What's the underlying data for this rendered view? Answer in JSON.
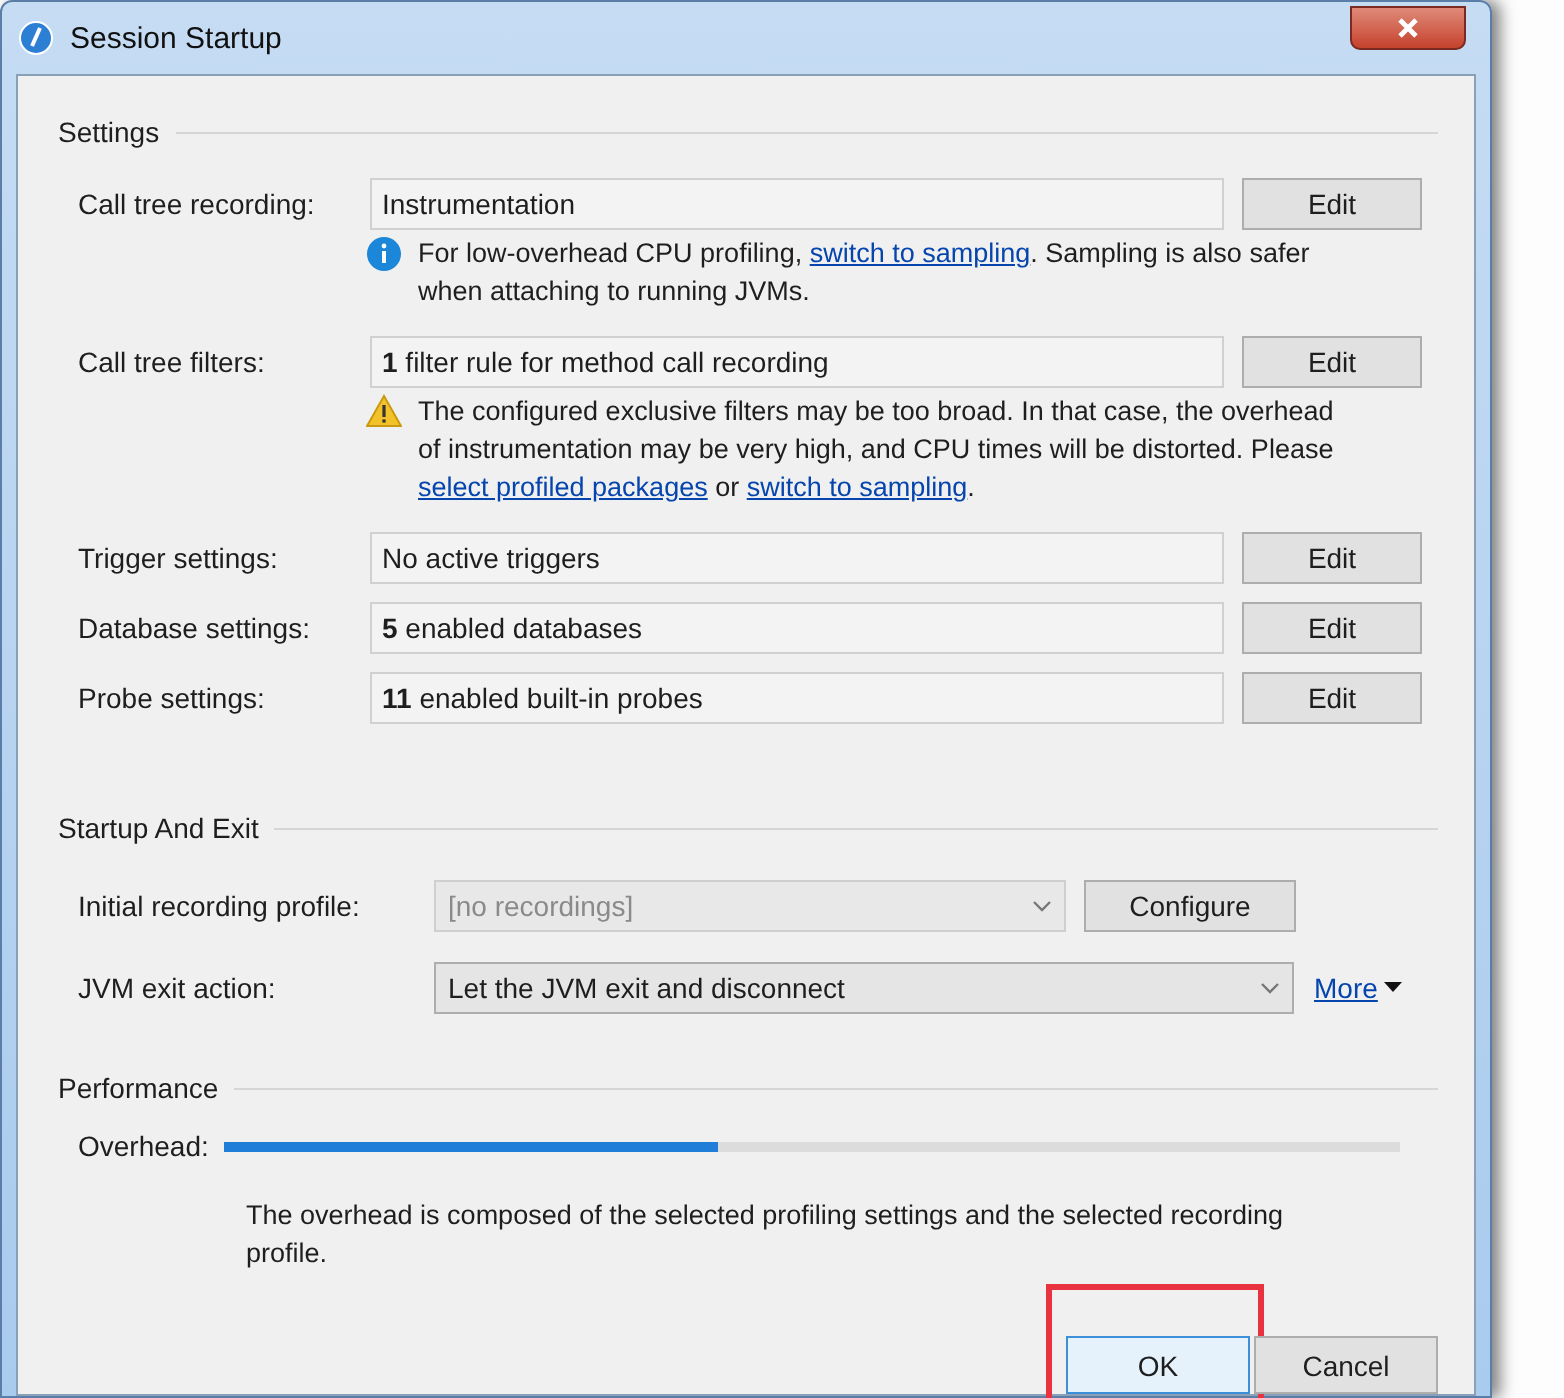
{
  "window": {
    "title": "Session Startup"
  },
  "settings": {
    "heading": "Settings",
    "rows": [
      {
        "label": "Call tree recording:",
        "value": "Instrumentation",
        "button": "Edit",
        "note": {
          "kind": "info",
          "parts": [
            {
              "kind": "text",
              "text": "For low-overhead CPU profiling, "
            },
            {
              "kind": "link",
              "text": "switch to sampling"
            },
            {
              "kind": "text",
              "text": ". Sampling is also safer when attaching to running JVMs."
            }
          ]
        }
      },
      {
        "label": "Call tree filters:",
        "value": "**1** filter rule for method call recording",
        "button": "Edit",
        "note": {
          "kind": "warning",
          "parts": [
            {
              "kind": "text",
              "text": "The configured exclusive filters may be too broad. In that case, the overhead of instrumentation may be very high, and CPU times will be distorted. Please "
            },
            {
              "kind": "link",
              "text": "select profiled packages"
            },
            {
              "kind": "text",
              "text": " or "
            },
            {
              "kind": "link",
              "text": "switch to sampling"
            },
            {
              "kind": "text",
              "text": "."
            }
          ]
        }
      },
      {
        "label": "Trigger settings:",
        "value": "No active triggers",
        "button": "Edit"
      },
      {
        "label": "Database settings:",
        "value": "**5** enabled databases",
        "button": "Edit"
      },
      {
        "label": "Probe settings:",
        "value": "**11** enabled built-in probes",
        "button": "Edit"
      }
    ]
  },
  "startup_and_exit": {
    "heading": "Startup And Exit",
    "rows": [
      {
        "label": "Initial recording profile:",
        "value": "[no recordings]",
        "disabled": true,
        "button": "Configure"
      },
      {
        "label": "JVM exit action:",
        "value": "Let the JVM exit and disconnect",
        "disabled": false,
        "link": "More"
      }
    ]
  },
  "performance": {
    "heading": "Performance",
    "label": "Overhead:",
    "level": 0.42,
    "description": "The overhead is composed of the selected profiling settings and the selected recording profile."
  },
  "buttons": [
    {
      "label": "OK",
      "default": true,
      "highlighted": true
    },
    {
      "label": "Cancel",
      "default": false,
      "highlighted": false
    }
  ]
}
